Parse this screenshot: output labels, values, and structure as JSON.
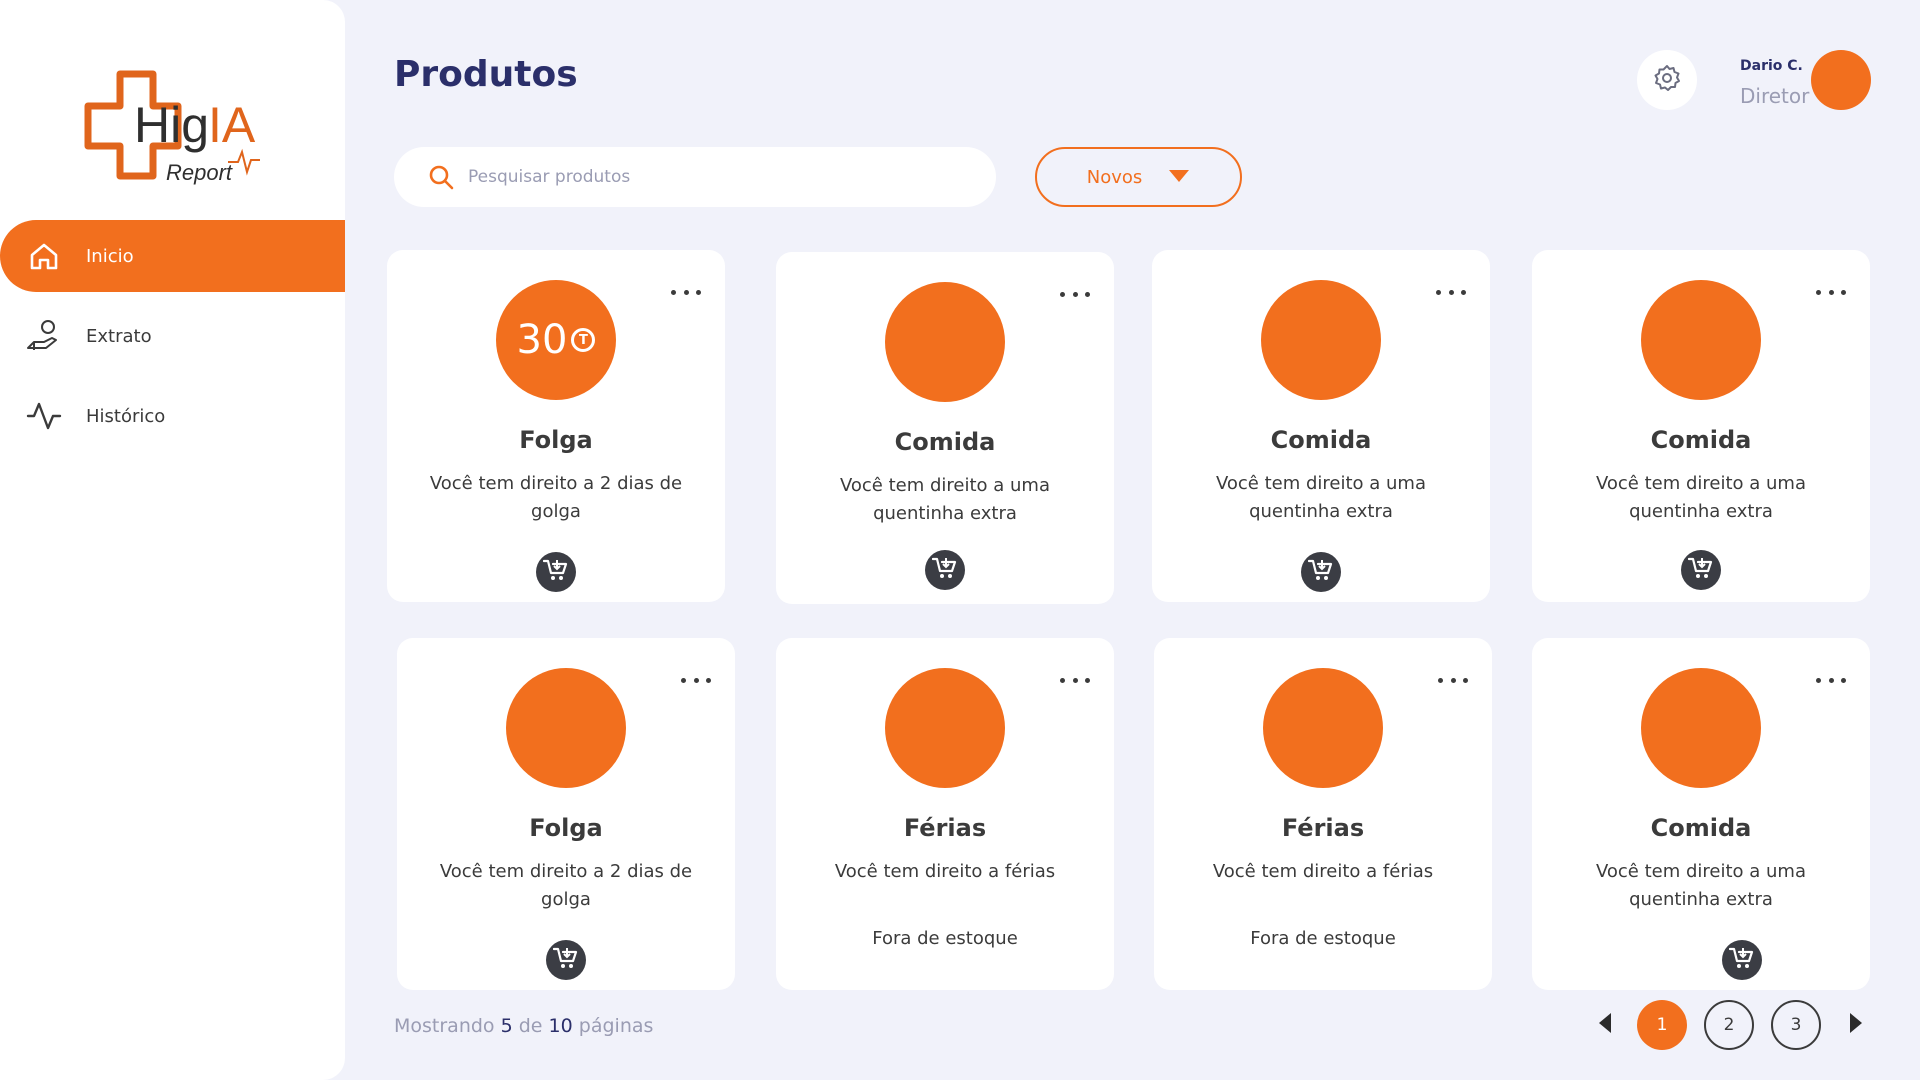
{
  "brand": {
    "logo_text": "HigIA",
    "logo_sub": "Report"
  },
  "sidebar": {
    "items": [
      {
        "label": "Inicio",
        "icon": "home-icon"
      },
      {
        "label": "Extrato",
        "icon": "hand-coin-icon"
      },
      {
        "label": "Histórico",
        "icon": "activity-icon"
      }
    ]
  },
  "header": {
    "title": "Produtos"
  },
  "user": {
    "name": "Dario C.",
    "role": "Diretor"
  },
  "search": {
    "placeholder": "Pesquisar produtos",
    "value": ""
  },
  "filter": {
    "selected": "Novos"
  },
  "products": [
    {
      "title": "Folga",
      "desc": "Você tem direito a 2 dias de golga",
      "price": "30",
      "stock": ""
    },
    {
      "title": "Comida",
      "desc": "Você tem direito a uma quentinha extra",
      "price": "",
      "stock": ""
    },
    {
      "title": "Comida",
      "desc": "Você tem direito a uma quentinha extra",
      "price": "",
      "stock": ""
    },
    {
      "title": "Comida",
      "desc": "Você tem direito a uma quentinha extra",
      "price": "",
      "stock": ""
    },
    {
      "title": "Folga",
      "desc": "Você tem direito a 2 dias de golga",
      "price": "",
      "stock": ""
    },
    {
      "title": "Férias",
      "desc": "Você tem direito a férias",
      "price": "",
      "stock": "Fora de estoque"
    },
    {
      "title": "Férias",
      "desc": "Você tem direito a férias",
      "price": "",
      "stock": "Fora de estoque"
    },
    {
      "title": "Comida",
      "desc": "Você tem direito a uma quentinha extra",
      "price": "",
      "stock": ""
    }
  ],
  "footer": {
    "prefix": "Mostrando",
    "current": "5",
    "middle": "de",
    "total": "10",
    "suffix": "páginas"
  },
  "pagination": {
    "pages": [
      "1",
      "2",
      "3"
    ],
    "active": "1"
  },
  "colors": {
    "accent": "#f26f1e",
    "title": "#2b2f6a",
    "background": "#f1f2fa"
  }
}
